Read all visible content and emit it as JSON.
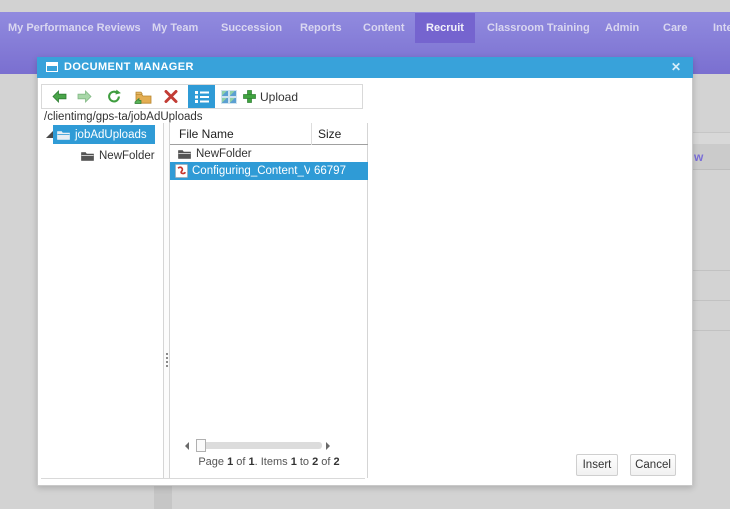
{
  "nav": {
    "tabs": [
      {
        "label": "My Performance Reviews",
        "active": false
      },
      {
        "label": "My Team",
        "active": false
      },
      {
        "label": "Succession",
        "active": false
      },
      {
        "label": "Reports",
        "active": false
      },
      {
        "label": "Content",
        "active": false
      },
      {
        "label": "Recruit",
        "active": true
      },
      {
        "label": "Classroom Training",
        "active": false
      },
      {
        "label": "Admin",
        "active": false
      },
      {
        "label": "Care",
        "active": false
      },
      {
        "label": "Inte",
        "active": false
      }
    ]
  },
  "page_background": {
    "partial_link": "w"
  },
  "dialog": {
    "title": "DOCUMENT MANAGER",
    "close_glyph": "✕",
    "toolbar": {
      "back_icon": "back-arrow",
      "forward_icon": "forward-arrow",
      "refresh_icon": "refresh",
      "new_folder_icon": "new-folder",
      "delete_icon": "delete-x",
      "list_view_icon": "list-view",
      "thumbnails_view_icon": "thumbnails-view",
      "upload_label": "Upload"
    },
    "address": "/clientimg/gps-ta/jobAdUploads",
    "tree": [
      {
        "label": "jobAdUploads",
        "selected": true,
        "expanded": true
      },
      {
        "label": "NewFolder",
        "selected": false,
        "expanded": false
      }
    ],
    "list": {
      "columns": [
        "File Name",
        "Size"
      ],
      "rows": [
        {
          "name": "NewFolder",
          "size": "",
          "type": "folder",
          "selected": false
        },
        {
          "name": "Configuring_Content_Vendo",
          "size": "66797",
          "type": "pdf",
          "selected": true
        }
      ],
      "pager_parts": [
        "Page ",
        "1",
        " of ",
        "1",
        ". Items ",
        "1",
        " to ",
        "2",
        " of ",
        "2"
      ]
    },
    "footer": {
      "insert_label": "Insert",
      "cancel_label": "Cancel"
    },
    "colors": {
      "titlebar_blue": "#38a2da",
      "selection_blue": "#2f9bd6",
      "nav_purple_top": "#918bdf",
      "nav_purple_bottom": "#7a6fd0",
      "active_tab_purple": "#7564cf"
    }
  }
}
